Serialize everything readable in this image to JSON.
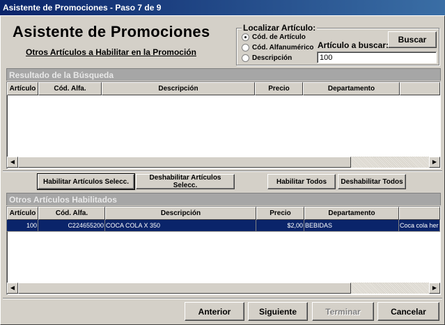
{
  "window": {
    "title": "Asistente de Promociones - Paso 7 de 9"
  },
  "header": {
    "title": "Asistente de Promociones",
    "subtitle": "Otros Artículos a Habilitar en la Promoción"
  },
  "search": {
    "group_label": "Localizar Artículo:",
    "options": [
      {
        "label": "Cód. de Artículo",
        "selected": true
      },
      {
        "label": "Cód. Alfanumérico",
        "selected": false
      },
      {
        "label": "Descripción",
        "selected": false
      }
    ],
    "field_label": "Artículo a buscar:",
    "value": "100",
    "button_label": "Buscar"
  },
  "results": {
    "panel_title": "Resultado de la Búsqueda",
    "columns": [
      "Artículo",
      "Cód. Alfa.",
      "Descripción",
      "Precio",
      "Departamento"
    ],
    "rows": []
  },
  "actions": {
    "enable_selected": "Habilitar Artículos Selecc.",
    "disable_selected": "Deshabilitar Artículos Selecc.",
    "enable_all": "Habilitar Todos",
    "disable_all": "Deshabilitar Todos"
  },
  "enabled": {
    "panel_title": "Otros Artículos Habilitados",
    "columns": [
      "Artículo",
      "Cód. Alfa.",
      "Descripción",
      "Precio",
      "Departamento"
    ],
    "rows": [
      {
        "articulo": "100",
        "cod_alfa": "C224655200",
        "descripcion": "COCA COLA X 350",
        "precio": "$2,00",
        "departamento": "BEBIDAS",
        "extra": "Coca cola her"
      }
    ]
  },
  "footer": {
    "back": "Anterior",
    "next": "Siguiente",
    "finish": "Terminar",
    "cancel": "Cancelar"
  },
  "colors": {
    "titlebar": "#0a246a",
    "selection": "#0a246a",
    "panel_header": "#a6a6a6",
    "face": "#d4d0c8"
  }
}
